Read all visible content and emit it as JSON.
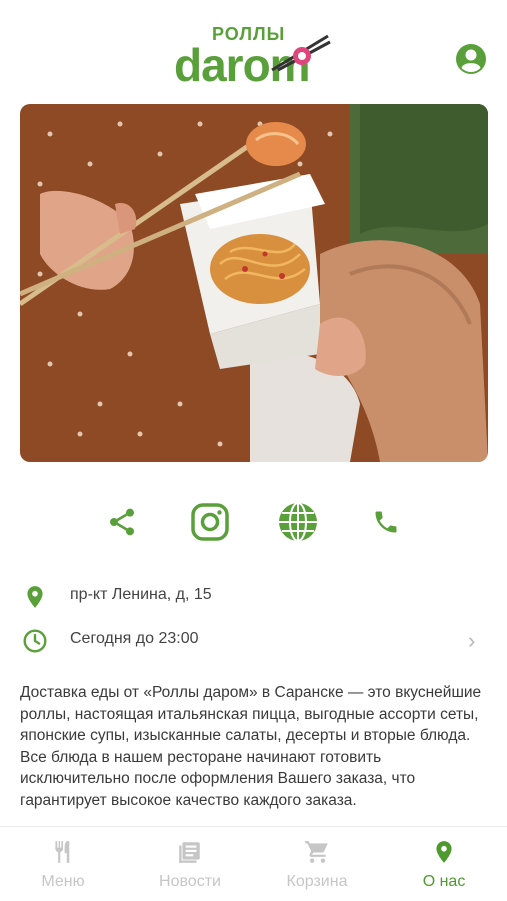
{
  "header": {
    "logo_small": "РОЛЛЫ",
    "logo_big": "darom"
  },
  "colors": {
    "brand_green": "#5aa03a",
    "inactive_gray": "#c6c6c6"
  },
  "actions": [
    {
      "icon": "share-icon"
    },
    {
      "icon": "instagram-icon"
    },
    {
      "icon": "globe-icon"
    },
    {
      "icon": "phone-icon"
    }
  ],
  "info": {
    "address": "пр-кт Ленина, д, 15",
    "hours": "Сегодня до 23:00"
  },
  "description": "Доставка еды от «Роллы даром» в Саранске — это вкуснейшие роллы, настоящая итальянская пицца, выгодные ассорти сеты, японские супы, изысканные салаты, десерты и вторые блюда. Все блюда в нашем ресторане начинают готовить исключительно после оформления Вашего заказа, что гарантирует высокое качество каждого заказа.",
  "tabs": [
    {
      "label": "Меню",
      "icon": "fork-knife-icon",
      "active": false
    },
    {
      "label": "Новости",
      "icon": "news-icon",
      "active": false
    },
    {
      "label": "Корзина",
      "icon": "cart-icon",
      "active": false
    },
    {
      "label": "О нас",
      "icon": "location-pin-icon",
      "active": true
    }
  ]
}
